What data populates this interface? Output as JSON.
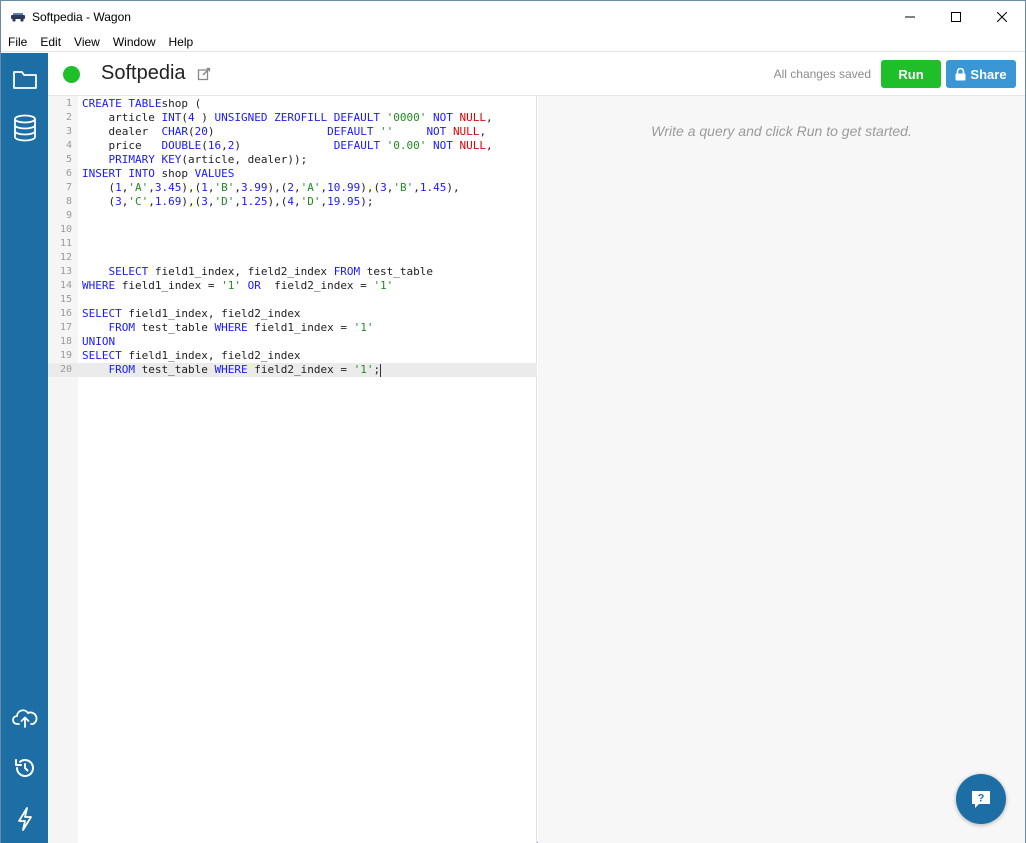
{
  "window": {
    "title": "Softpedia - Wagon"
  },
  "menu": [
    "File",
    "Edit",
    "View",
    "Window",
    "Help"
  ],
  "sidebar": {
    "top": [
      "folder-icon",
      "database-icon"
    ],
    "bottom": [
      "cloud-upload-icon",
      "history-icon",
      "lightning-icon"
    ]
  },
  "header": {
    "doc_title": "Softpedia",
    "save_status": "All changes saved",
    "run_label": "Run",
    "share_label": "Share"
  },
  "editor": {
    "lines": [
      {
        "n": "1",
        "tokens": [
          [
            "kw",
            "CREATE TABLE"
          ],
          [
            "",
            "shop ("
          ]
        ]
      },
      {
        "n": "2",
        "tokens": [
          [
            "",
            "    article "
          ],
          [
            "kw",
            "INT"
          ],
          [
            "",
            "("
          ],
          [
            "num",
            "4"
          ],
          [
            "",
            " ) "
          ],
          [
            "kw",
            "UNSIGNED ZEROFILL DEFAULT"
          ],
          [
            "",
            ""
          ],
          [
            "str",
            " '0000'"
          ],
          [
            "kw",
            " NOT "
          ],
          [
            "nul",
            "NULL"
          ],
          [
            "",
            ","
          ]
        ]
      },
      {
        "n": "3",
        "tokens": [
          [
            "",
            "    dealer  "
          ],
          [
            "kw",
            "CHAR"
          ],
          [
            "",
            "("
          ],
          [
            "num",
            "20"
          ],
          [
            "",
            ")                 "
          ],
          [
            "kw",
            "DEFAULT"
          ],
          [
            "str",
            " ''"
          ],
          [
            "",
            "     "
          ],
          [
            "kw",
            "NOT "
          ],
          [
            "nul",
            "NULL"
          ],
          [
            "",
            ","
          ]
        ]
      },
      {
        "n": "4",
        "tokens": [
          [
            "",
            "    price   "
          ],
          [
            "kw",
            "DOUBLE"
          ],
          [
            "",
            "("
          ],
          [
            "num",
            "16"
          ],
          [
            "",
            ","
          ],
          [
            "num",
            "2"
          ],
          [
            "",
            ")              "
          ],
          [
            "kw",
            "DEFAULT"
          ],
          [
            "str",
            " '0.00'"
          ],
          [
            "kw",
            " NOT "
          ],
          [
            "nul",
            "NULL"
          ],
          [
            "",
            ","
          ]
        ]
      },
      {
        "n": "5",
        "tokens": [
          [
            "",
            "    "
          ],
          [
            "kw",
            "PRIMARY KEY"
          ],
          [
            "",
            "(article, dealer));"
          ]
        ]
      },
      {
        "n": "6",
        "tokens": [
          [
            "kw",
            "INSERT INTO"
          ],
          [
            "",
            " shop "
          ],
          [
            "kw",
            "VALUES"
          ]
        ]
      },
      {
        "n": "7",
        "tokens": [
          [
            "",
            "    ("
          ],
          [
            "num",
            "1"
          ],
          [
            "",
            ","
          ],
          [
            "str",
            "'A'"
          ],
          [
            "",
            ","
          ],
          [
            "num",
            "3.45"
          ],
          [
            "",
            "),("
          ],
          [
            "num",
            "1"
          ],
          [
            "",
            ","
          ],
          [
            "str",
            "'B'"
          ],
          [
            "",
            ","
          ],
          [
            "num",
            "3.99"
          ],
          [
            "",
            "),("
          ],
          [
            "num",
            "2"
          ],
          [
            "",
            ","
          ],
          [
            "str",
            "'A'"
          ],
          [
            "",
            ","
          ],
          [
            "num",
            "10.99"
          ],
          [
            "",
            "),("
          ],
          [
            "num",
            "3"
          ],
          [
            "",
            ","
          ],
          [
            "str",
            "'B'"
          ],
          [
            "",
            ","
          ],
          [
            "num",
            "1.45"
          ],
          [
            "",
            "),"
          ]
        ]
      },
      {
        "n": "8",
        "tokens": [
          [
            "",
            "    ("
          ],
          [
            "num",
            "3"
          ],
          [
            "",
            ","
          ],
          [
            "str",
            "'C'"
          ],
          [
            "",
            ","
          ],
          [
            "num",
            "1.69"
          ],
          [
            "",
            "),("
          ],
          [
            "num",
            "3"
          ],
          [
            "",
            ","
          ],
          [
            "str",
            "'D'"
          ],
          [
            "",
            ","
          ],
          [
            "num",
            "1.25"
          ],
          [
            "",
            "),("
          ],
          [
            "num",
            "4"
          ],
          [
            "",
            ","
          ],
          [
            "str",
            "'D'"
          ],
          [
            "",
            ","
          ],
          [
            "num",
            "19.95"
          ],
          [
            "",
            ");"
          ]
        ]
      },
      {
        "n": "9",
        "tokens": []
      },
      {
        "n": "10",
        "tokens": []
      },
      {
        "n": "11",
        "tokens": []
      },
      {
        "n": "12",
        "tokens": []
      },
      {
        "n": "13",
        "tokens": [
          [
            "",
            "    "
          ],
          [
            "kw",
            "SELECT"
          ],
          [
            "",
            " field1_index, field2_index "
          ],
          [
            "kw",
            "FROM"
          ],
          [
            "",
            " test_table"
          ]
        ]
      },
      {
        "n": "14",
        "tokens": [
          [
            "kw",
            "WHERE"
          ],
          [
            "",
            " field1_index = "
          ],
          [
            "str",
            "'1'"
          ],
          [
            "kw",
            " OR"
          ],
          [
            "",
            "  field2_index = "
          ],
          [
            "str",
            "'1'"
          ]
        ]
      },
      {
        "n": "15",
        "tokens": []
      },
      {
        "n": "16",
        "tokens": [
          [
            "kw",
            "SELECT"
          ],
          [
            "",
            " field1_index, field2_index"
          ]
        ]
      },
      {
        "n": "17",
        "tokens": [
          [
            "",
            "    "
          ],
          [
            "kw",
            "FROM"
          ],
          [
            "",
            " test_table "
          ],
          [
            "kw",
            "WHERE"
          ],
          [
            "",
            " field1_index = "
          ],
          [
            "str",
            "'1'"
          ]
        ]
      },
      {
        "n": "18",
        "tokens": [
          [
            "kw",
            "UNION"
          ]
        ]
      },
      {
        "n": "19",
        "tokens": [
          [
            "kw",
            "SELECT"
          ],
          [
            "",
            " field1_index, field2_index"
          ]
        ]
      },
      {
        "n": "20",
        "tokens": [
          [
            "",
            "    "
          ],
          [
            "kw",
            "FROM"
          ],
          [
            "",
            " test_table "
          ],
          [
            "kw",
            "WHERE"
          ],
          [
            "",
            " field2_index = "
          ],
          [
            "str",
            "'1'"
          ],
          [
            "",
            ";"
          ]
        ]
      }
    ],
    "active_line": 20
  },
  "results": {
    "hint": "Write a query and click Run to get started."
  },
  "colors": {
    "sidebar": "#1c6ea4",
    "run": "#1fbf2a",
    "share": "#3a96d4",
    "status_dot": "#1fbf2a"
  }
}
